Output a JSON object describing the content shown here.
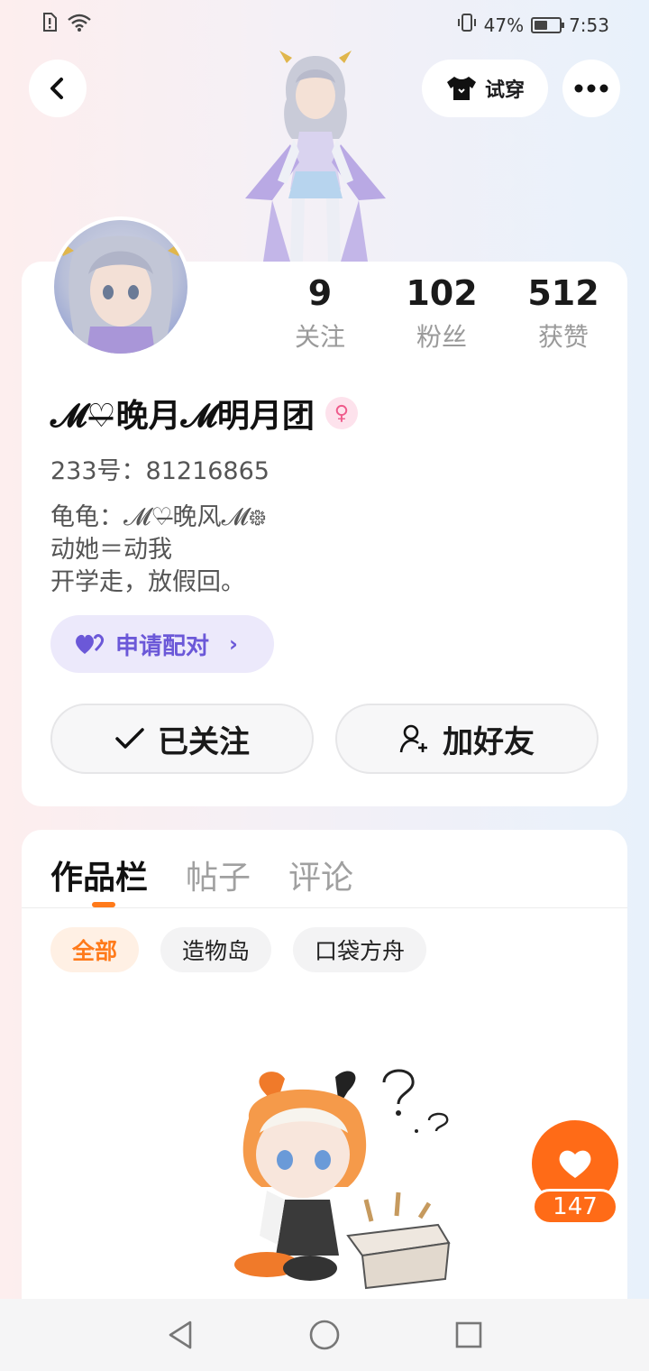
{
  "status_bar": {
    "battery": "47%",
    "time": "7:53"
  },
  "header": {
    "try_on_label": "试穿"
  },
  "stats": [
    {
      "value": "9",
      "label": "关注"
    },
    {
      "value": "102",
      "label": "粉丝"
    },
    {
      "value": "512",
      "label": "获赞"
    }
  ],
  "profile": {
    "nickname": "𝓜♡̶晚月𝓜明月团",
    "gender_symbol": "♀",
    "uid": "233号：81216865",
    "bio": [
      "龟龟：𝓜♡̶晚风𝓜᪥",
      "动她＝动我",
      "开学走，放假回。"
    ],
    "pair_button": "申请配对",
    "followed_button": "已关注",
    "add_friend_button": "加好友"
  },
  "works": {
    "tabs": [
      "作品栏",
      "帖子",
      "评论"
    ],
    "chips": [
      "全部",
      "造物岛",
      "口袋方舟"
    ]
  },
  "like": {
    "count": "147"
  },
  "colors": {
    "accent": "#ff7a1a",
    "pair": "#6b58d8"
  }
}
